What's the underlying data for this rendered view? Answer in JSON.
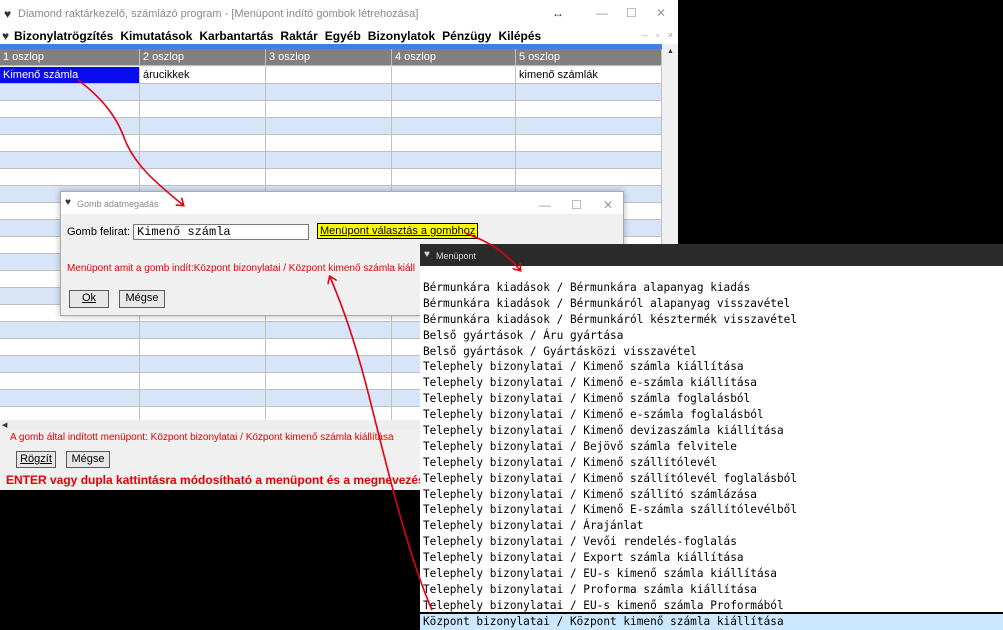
{
  "main_window": {
    "title": "Diamond raktárkezelő, számlázó program - [Menüpont indító gombok létrehozása]",
    "menu": [
      "Bizonylatrögzítés",
      "Kimutatások",
      "Karbantartás",
      "Raktár",
      "Egyéb",
      "Bizonylatok",
      "Pénzügy",
      "Kilépés"
    ],
    "grid": {
      "headers": [
        "1 oszlop",
        "2 oszlop",
        "3 oszlop",
        "4 oszlop",
        "5 oszlop"
      ],
      "rows": [
        [
          "Kimenő számla",
          "árucikkek",
          "",
          "",
          "kimenő számlák"
        ],
        [
          "",
          "",
          "",
          "",
          ""
        ],
        [
          "",
          "",
          "",
          "",
          ""
        ],
        [
          "",
          "",
          "",
          "",
          ""
        ],
        [
          "",
          "",
          "",
          "",
          ""
        ],
        [
          "",
          "",
          "",
          "",
          ""
        ],
        [
          "",
          "",
          "",
          "",
          ""
        ],
        [
          "",
          "",
          "",
          "",
          ""
        ],
        [
          "",
          "",
          "",
          "",
          ""
        ],
        [
          "",
          "",
          "",
          "",
          ""
        ],
        [
          "",
          "",
          "",
          "",
          ""
        ],
        [
          "",
          "",
          "",
          "",
          ""
        ],
        [
          "",
          "",
          "",
          "",
          ""
        ],
        [
          "",
          "",
          "",
          "",
          ""
        ],
        [
          "",
          "",
          "",
          "",
          ""
        ],
        [
          "",
          "",
          "",
          "",
          ""
        ],
        [
          "",
          "",
          "",
          "",
          ""
        ],
        [
          "",
          "",
          "",
          "",
          ""
        ],
        [
          "",
          "",
          "",
          "",
          ""
        ],
        [
          "",
          "",
          "",
          "",
          ""
        ],
        [
          "",
          "",
          "",
          "",
          ""
        ]
      ]
    },
    "status_line": "A gomb által indított menüpont: Központ bizonylatai / Központ kimenő számla kiállítása",
    "record_button": "Rögzít",
    "cancel_button": "Mégse",
    "hint": "ENTER vagy dupla kattintásra módosítható a menüpont és a megnevezés. A tábla"
  },
  "dialog": {
    "title": "Gomb adatmegadás",
    "label": "Gomb felirat:",
    "input_value": "Kimenő számla",
    "select_button": "Menüpont választás a gombhoz",
    "info": "Menüpont amit a gomb indít:Központ bizonylatai / Központ kimenő számla kiáll",
    "ok": "Ok",
    "cancel": "Mégse"
  },
  "popup": {
    "title": "Menüpont",
    "items": [
      "Bérmunkára kiadások / Bérmunkára alapanyag kiadás",
      "Bérmunkára kiadások / Bérmunkáról alapanyag visszavétel",
      "Bérmunkára kiadások / Bérmunkáról késztermék visszavétel",
      "Belső gyártások / Áru gyártása",
      "Belső gyártások / Gyártásközi visszavétel",
      "Telephely bizonylatai / Kimenő számla kiállítása",
      "Telephely bizonylatai / Kimenő e-számla kiállítása",
      "Telephely bizonylatai / Kimenő számla foglalásból",
      "Telephely bizonylatai / Kimenő e-számla foglalásból",
      "Telephely bizonylatai / Kimenő devizaszámla kiállítása",
      "Telephely bizonylatai / Bejövő számla felvitele",
      "Telephely bizonylatai / Kimenő szállítólevél",
      "Telephely bizonylatai / Kimenő szállítólevél foglalásból",
      "Telephely bizonylatai / Kimenő szállító számlázása",
      "Telephely bizonylatai / Kimenő E-számla szállítólevélből",
      "Telephely bizonylatai / Árajánlat",
      "Telephely bizonylatai / Vevői rendelés-foglalás",
      "Telephely bizonylatai / Export számla kiállítása",
      "Telephely bizonylatai / EU-s kimenő számla kiállítása",
      "Telephely bizonylatai / Proforma számla kiállítása",
      "Telephely bizonylatai / EU-s kimenő számla Proformából",
      "Központ bizonylatai / Központ kimenő számla kiállítása"
    ],
    "highlighted_index": 21
  },
  "colors": {
    "selection": "#0a0cf0",
    "row_alt": "#d8e4f7",
    "header": "#808080",
    "status_red": "#e60000",
    "annotation_arrow": "#e3000f",
    "yellow_button": "#ffff00"
  }
}
